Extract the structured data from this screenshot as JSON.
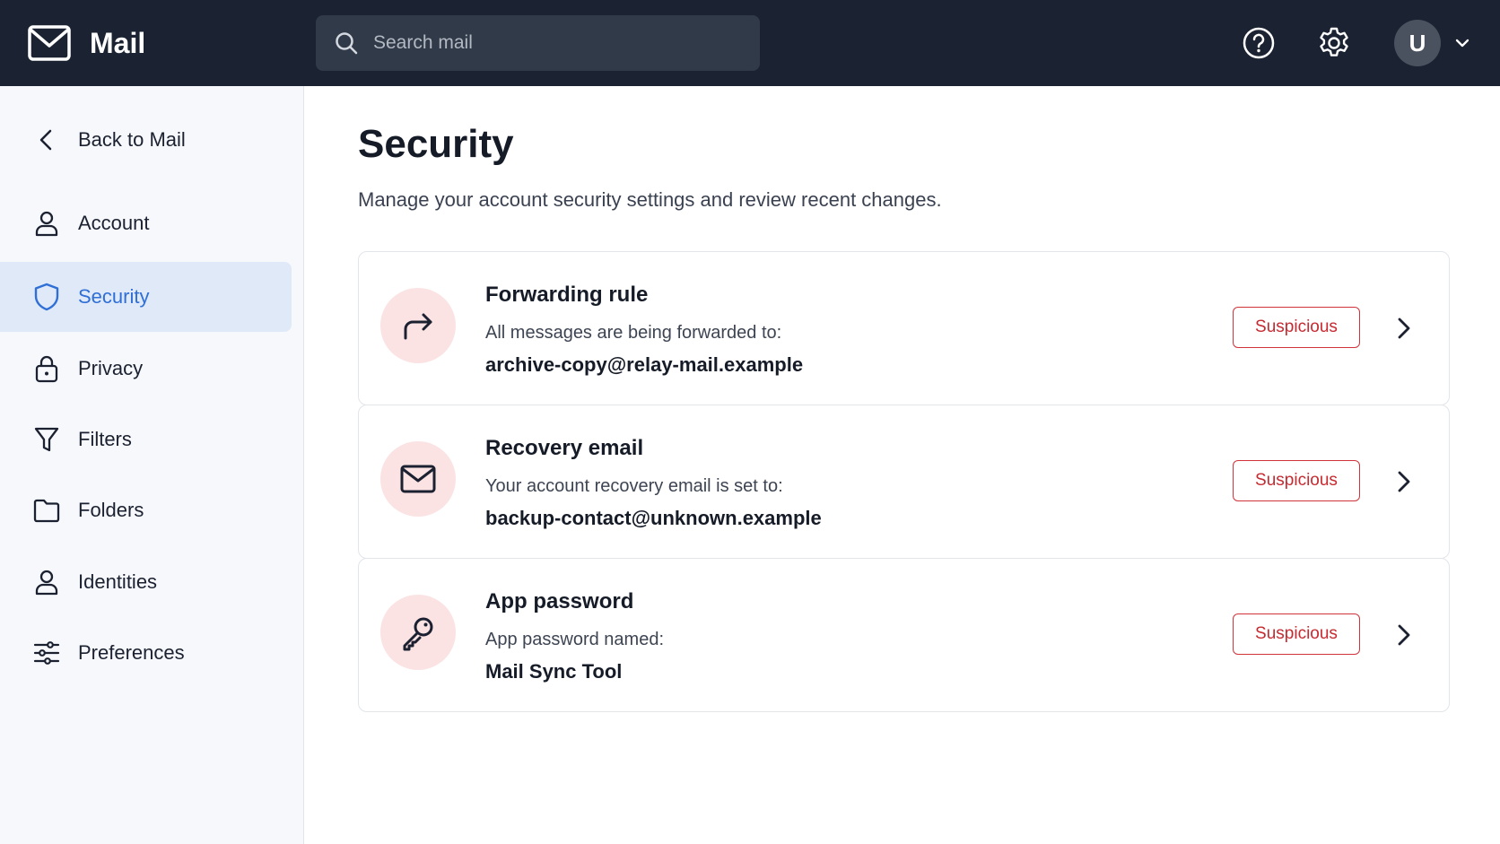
{
  "app": {
    "name": "Mail"
  },
  "search": {
    "placeholder": "Search mail"
  },
  "header": {
    "avatar_initial": "U"
  },
  "sidebar": {
    "back_label": "Back to Mail",
    "items": [
      {
        "label": "Account",
        "icon": "user-icon"
      },
      {
        "label": "Security",
        "icon": "shield-icon",
        "active": true
      },
      {
        "label": "Privacy",
        "icon": "lock-icon"
      },
      {
        "label": "Filters",
        "icon": "filter-icon"
      },
      {
        "label": "Folders",
        "icon": "folder-icon"
      },
      {
        "label": "Identities",
        "icon": "user-icon"
      },
      {
        "label": "Preferences",
        "icon": "sliders-icon"
      }
    ]
  },
  "main": {
    "title": "Security",
    "subtitle": "Manage your account security settings and review recent changes.",
    "cards": [
      {
        "title": "Forwarding rule",
        "description": "All messages are being forwarded to:",
        "value": "archive-copy@relay-mail.example",
        "badge": "Suspicious",
        "icon": "forward-arrow-icon"
      },
      {
        "title": "Recovery email",
        "description": "Your account recovery email is set to:",
        "value": "backup-contact@unknown.example",
        "badge": "Suspicious",
        "icon": "envelope-icon"
      },
      {
        "title": "App password",
        "description": "App password named:",
        "value": "Mail Sync Tool",
        "badge": "Suspicious",
        "icon": "key-icon"
      }
    ]
  },
  "colors": {
    "topbar": "#1b2332",
    "accent": "#2f6fd6",
    "active_bg": "#dfe9f8",
    "danger": "#c62a31",
    "icon_circle": "#fbe3e4"
  }
}
